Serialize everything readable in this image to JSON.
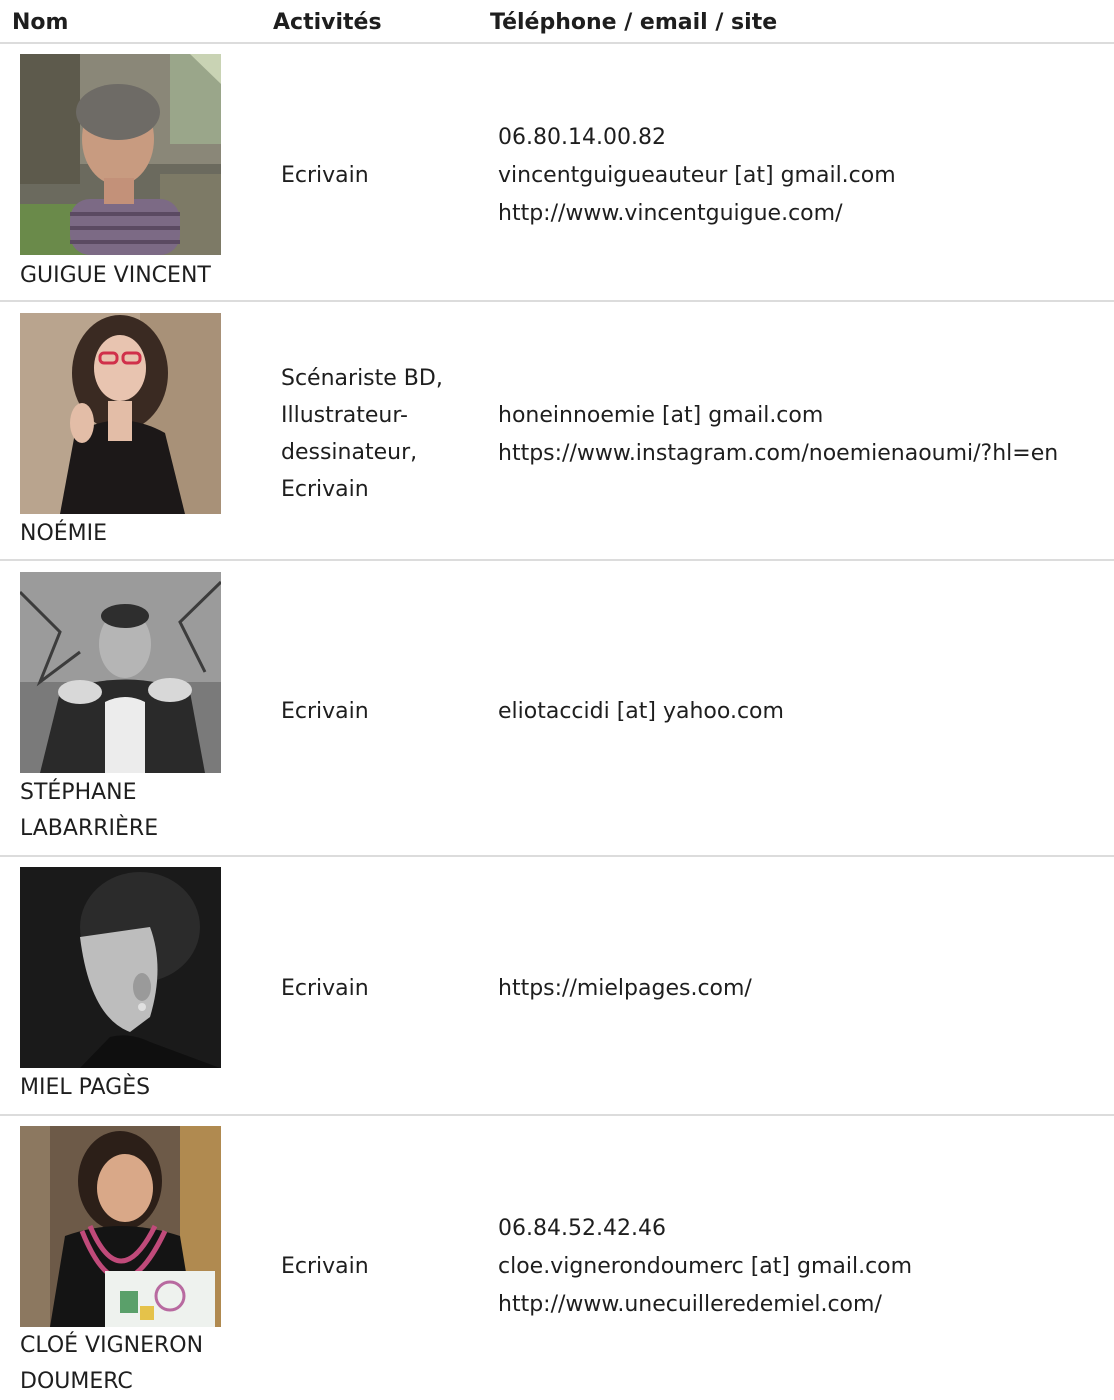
{
  "table": {
    "headers": {
      "name": "Nom",
      "activities": "Activités",
      "contact": "Téléphone / email / site"
    },
    "rows": [
      {
        "photo": "portrait-photo",
        "name": "GUIGUE VINCENT",
        "activities": [
          "Ecrivain"
        ],
        "contact": [
          "06.80.14.00.82",
          "vincentguigueauteur [at] gmail.com",
          "http://www.vincentguigue.com/"
        ]
      },
      {
        "photo": "portrait-photo",
        "name": "NOÉMIE",
        "activities": [
          "Scénariste BD,",
          "Illustrateur-",
          "dessinateur,",
          "Ecrivain"
        ],
        "contact": [
          "honeinnoemie [at] gmail.com",
          "https://www.instagram.com/noemienaoumi/?hl=en"
        ]
      },
      {
        "photo": "portrait-photo",
        "name_lines": [
          "STÉPHANE",
          "LABARRIÈRE"
        ],
        "activities": [
          "Ecrivain"
        ],
        "contact": [
          "eliotaccidi [at] yahoo.com"
        ]
      },
      {
        "photo": "portrait-photo",
        "name": "MIEL PAGÈS",
        "activities": [
          "Ecrivain"
        ],
        "contact": [
          "https://mielpages.com/"
        ]
      },
      {
        "photo": "portrait-photo",
        "name_lines": [
          "CLOÉ VIGNERON",
          "DOUMERC"
        ],
        "activities": [
          "Ecrivain"
        ],
        "contact": [
          "06.84.52.42.46",
          "cloe.vignerondoumerc [at] gmail.com",
          "http://www.unecuilleredemiel.com/"
        ]
      }
    ]
  },
  "colors": {
    "text": "#1e1e1e",
    "divider": "#dcdcdc",
    "background": "#ffffff"
  }
}
